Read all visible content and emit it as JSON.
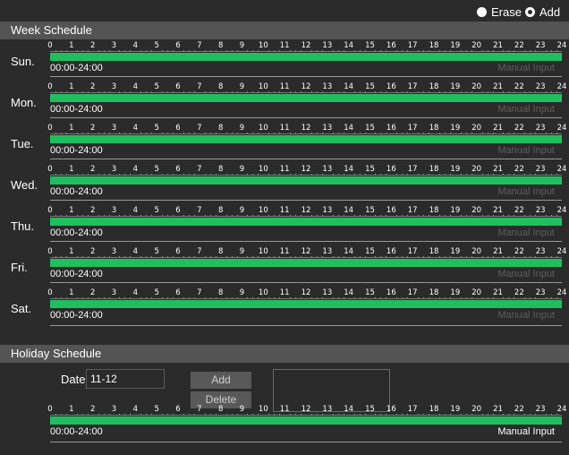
{
  "mode": {
    "erase_label": "Erase",
    "add_label": "Add",
    "selected": "Add"
  },
  "week_schedule": {
    "title": "Week Schedule",
    "hours": [
      "0",
      "1",
      "2",
      "3",
      "4",
      "5",
      "6",
      "7",
      "8",
      "9",
      "10",
      "11",
      "12",
      "13",
      "14",
      "15",
      "16",
      "17",
      "18",
      "19",
      "20",
      "21",
      "22",
      "23",
      "24"
    ],
    "days": [
      {
        "label": "Sun.",
        "time": "00:00-24:00",
        "manual": "Manual Input"
      },
      {
        "label": "Mon.",
        "time": "00:00-24:00",
        "manual": "Manual Input"
      },
      {
        "label": "Tue.",
        "time": "00:00-24:00",
        "manual": "Manual Input"
      },
      {
        "label": "Wed.",
        "time": "00:00-24:00",
        "manual": "Manual Input"
      },
      {
        "label": "Thu.",
        "time": "00:00-24:00",
        "manual": "Manual Input"
      },
      {
        "label": "Fri.",
        "time": "00:00-24:00",
        "manual": "Manual Input"
      },
      {
        "label": "Sat.",
        "time": "00:00-24:00",
        "manual": "Manual Input"
      }
    ]
  },
  "holiday_schedule": {
    "title": "Holiday Schedule",
    "date_label": "Date",
    "date_value": "11-12",
    "add_label": "Add",
    "delete_label": "Delete",
    "time": "00:00-24:00",
    "manual": "Manual Input"
  },
  "colors": {
    "bar": "#1fbf5f",
    "header": "#545454",
    "background": "#2b2b2b"
  }
}
